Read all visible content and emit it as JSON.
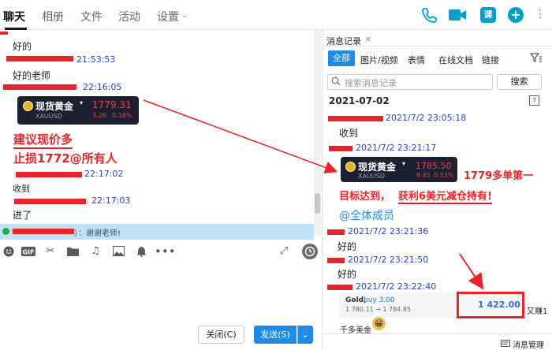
{
  "nav": {
    "tabs": [
      "聊天",
      "相册",
      "文件",
      "活动",
      "设置"
    ]
  },
  "chat": {
    "messages": [
      {
        "text": "好的"
      },
      {
        "time": "21:53:53"
      },
      {
        "text": "好的老师"
      },
      {
        "time": "22:16:05"
      },
      {
        "time": "22:17:02"
      },
      {
        "text": "收到"
      },
      {
        "time": "22:17:03"
      },
      {
        "text": "进了"
      }
    ],
    "gold_card": {
      "name": "现货黄金",
      "code": "XAUUSD",
      "price": "1779.31",
      "change": "3.26",
      "percent": "0.18%"
    },
    "annot1": "建议现价多",
    "annot2": "止损1772@所有人",
    "preview": "）：谢谢老师!"
  },
  "toolbar": {
    "close_label": "关闭(C)",
    "send_label": "发送(S)"
  },
  "history": {
    "title": "消息记录",
    "filters": [
      "全部",
      "图片/视频",
      "表情",
      "在线文档",
      "链接"
    ],
    "search_placeholder": "搜索消息记录",
    "search_button": "搜索",
    "date": "2021-07-02",
    "entries": [
      {
        "time": "2021/7/2 23:05:18",
        "text": "收到"
      },
      {
        "time": "2021/7/2 23:21:17"
      },
      {
        "time": "2021/7/2 23:21:36",
        "text": "好的"
      },
      {
        "time": "2021/7/2 23:21:50",
        "text": "好的"
      },
      {
        "time": "2021/7/2 23:22:40"
      }
    ],
    "gold_card": {
      "name": "现货黄金",
      "code": "XAUUSD",
      "price": "1785.50",
      "change": "9.45",
      "percent": "0.53%"
    },
    "annot_a": "1779多单第一",
    "annot_b1": "目标达到，",
    "annot_b2": "获利6美元减仓持有!",
    "mention": "@全体成员",
    "trade": {
      "title": "Gold,",
      "side": "buy 3.00",
      "prices": "1 780.11 → 1 784.85",
      "profit": "1 422.00",
      "suffix": "又赚1",
      "caption": "千多美金"
    },
    "manage": "消息管理"
  },
  "colors": {
    "accent": "#1e8be5",
    "annotation_red": "#e8242a",
    "time_blue": "#2b3fd6"
  }
}
